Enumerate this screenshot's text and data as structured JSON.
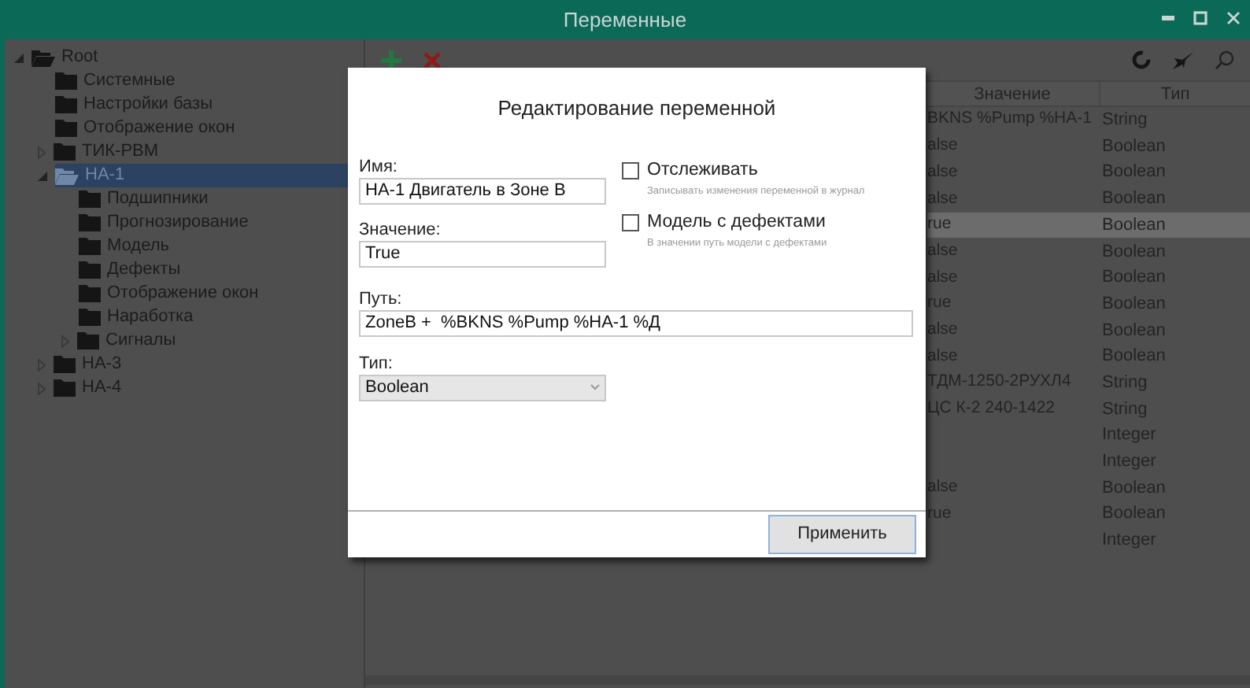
{
  "window": {
    "title": "Переменные"
  },
  "tree": [
    {
      "label": "Root",
      "expanded": true,
      "selected": false,
      "children": [
        {
          "label": "Системные",
          "selected": false
        },
        {
          "label": "Настройки базы",
          "selected": false
        },
        {
          "label": "Отображение окон",
          "selected": false
        },
        {
          "label": "ТИК-РВМ",
          "expanded": false,
          "selected": false
        },
        {
          "label": "НА-1",
          "expanded": true,
          "selected": true,
          "children": [
            {
              "label": "Подшипники",
              "selected": false
            },
            {
              "label": "Прогнозирование",
              "selected": false
            },
            {
              "label": "Модель",
              "selected": false
            },
            {
              "label": "Дефекты",
              "selected": false
            },
            {
              "label": "Отображение окон",
              "selected": false
            },
            {
              "label": "Наработка",
              "selected": false
            },
            {
              "label": "Сигналы",
              "expanded": false,
              "selected": false
            }
          ]
        },
        {
          "label": "НА-3",
          "expanded": false,
          "selected": false
        },
        {
          "label": "НА-4",
          "expanded": false,
          "selected": false
        }
      ]
    }
  ],
  "table": {
    "columns": [
      "Значение",
      "Тип"
    ],
    "rows": [
      {
        "value": "BKNS %Pump %HA-1",
        "type": "String",
        "selected": false
      },
      {
        "value": "alse",
        "type": "Boolean",
        "selected": false
      },
      {
        "value": "alse",
        "type": "Boolean",
        "selected": false
      },
      {
        "value": "alse",
        "type": "Boolean",
        "selected": false
      },
      {
        "value": "rue",
        "type": "Boolean",
        "selected": true
      },
      {
        "value": "alse",
        "type": "Boolean",
        "selected": false
      },
      {
        "value": "alse",
        "type": "Boolean",
        "selected": false
      },
      {
        "value": "rue",
        "type": "Boolean",
        "selected": false
      },
      {
        "value": "alse",
        "type": "Boolean",
        "selected": false
      },
      {
        "value": "alse",
        "type": "Boolean",
        "selected": false
      },
      {
        "value": "ТДМ-1250-2РУХЛ4",
        "type": "String",
        "selected": false
      },
      {
        "value": "ЦС К-2 240-1422",
        "type": "String",
        "selected": false
      },
      {
        "type": "Integer",
        "selected": false
      },
      {
        "type": "Integer",
        "selected": false
      },
      {
        "value": "alse",
        "type": "Boolean",
        "selected": false
      },
      {
        "value": "rue",
        "type": "Boolean",
        "selected": false
      },
      {
        "type": "Integer",
        "selected": false
      }
    ]
  },
  "dialog": {
    "title": "Редактирование переменной",
    "name": {
      "label": "Имя:",
      "value": "НА-1 Двигатель в Зоне В"
    },
    "value": {
      "label": "Значение:",
      "value": "True"
    },
    "checkboxes": [
      {
        "label": "Отслеживать",
        "hint": "Записывать изменения переменной в журнал",
        "checked": false
      },
      {
        "label": "Модель с дефектами",
        "hint": "В значении путь модели с дефектами",
        "checked": false
      }
    ],
    "path": {
      "label": "Путь:",
      "value": "ZoneB +  %BKNS %Pump %HA-1 %Д"
    },
    "type": {
      "label": "Тип:",
      "value": "Boolean"
    },
    "apply_button": "Применить"
  }
}
